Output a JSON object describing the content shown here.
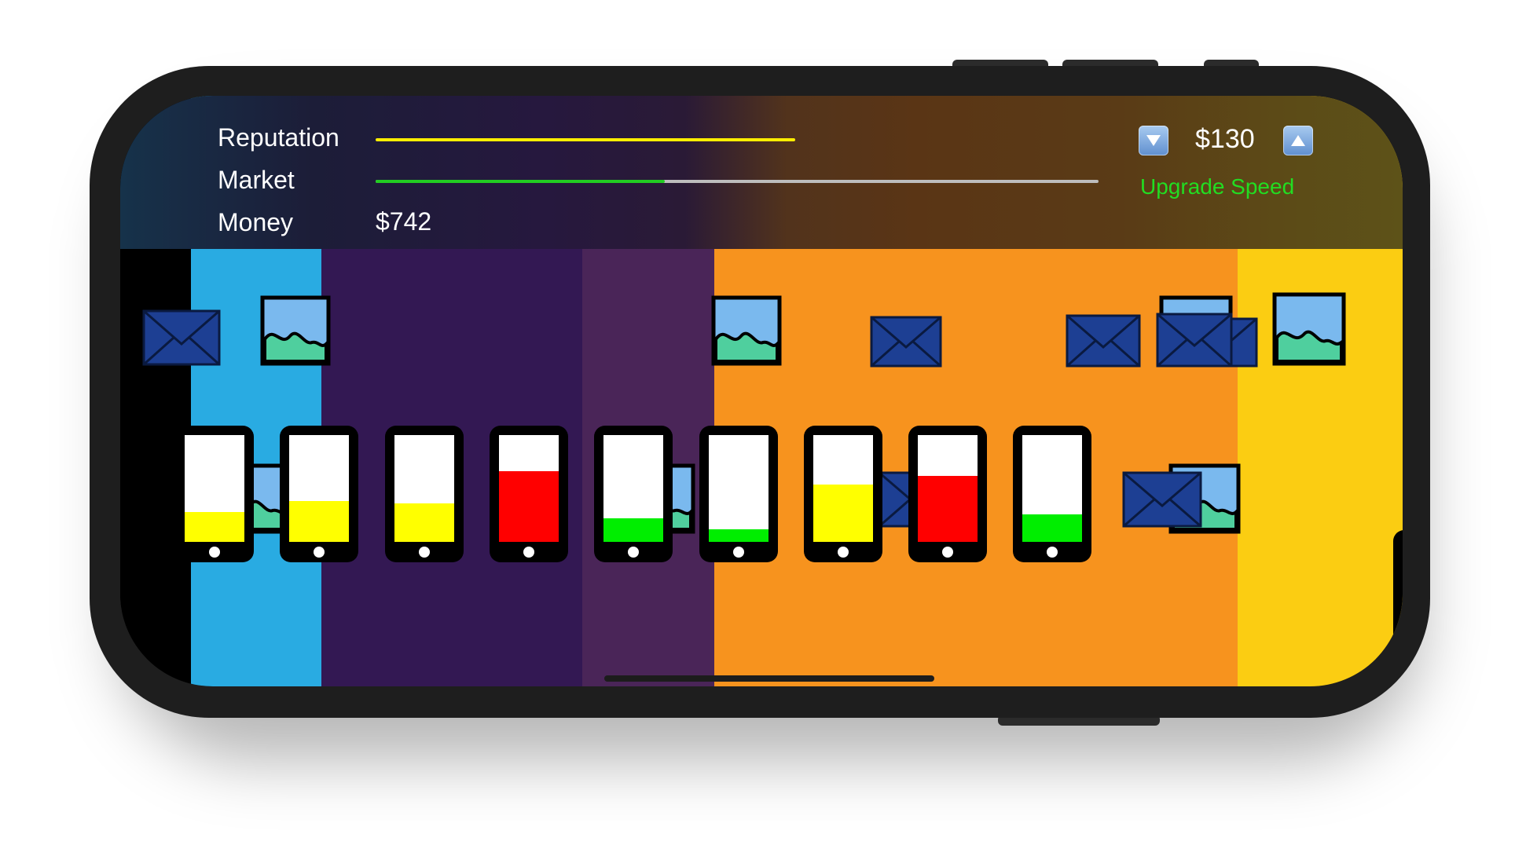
{
  "hud": {
    "reputation_label": "Reputation",
    "market_label": "Market",
    "money_label": "Money",
    "money_value": "$742",
    "reputation_level": 0.58,
    "market_level": 0.4,
    "price": "$130",
    "upgrade_label": "Upgrade Speed",
    "decrease_icon": "triangle-down-icon",
    "increase_icon": "triangle-up-icon"
  },
  "colors": {
    "reputation": "#ffee00",
    "market": "#22cc22",
    "upgrade": "#22dd22",
    "band_black": "#000000",
    "band_blue": "#29abe2",
    "band_purple": "#331853",
    "band_violet": "#4a2558",
    "band_orange": "#f7931e",
    "band_yellow": "#fbcd12",
    "fill_yellow": "#ffff00",
    "fill_red": "#ff0000",
    "fill_green": "#00ee00",
    "envelope": "#1d3f93",
    "image_sky": "#7ab9ee",
    "image_hill": "#4fcf9e"
  },
  "phones": [
    {
      "fill": 0.28,
      "color": "yellow"
    },
    {
      "fill": 0.38,
      "color": "yellow"
    },
    {
      "fill": 0.36,
      "color": "yellow"
    },
    {
      "fill": 0.66,
      "color": "red"
    },
    {
      "fill": 0.22,
      "color": "green"
    },
    {
      "fill": 0.12,
      "color": "green"
    },
    {
      "fill": 0.54,
      "color": "yellow"
    },
    {
      "fill": 0.62,
      "color": "red"
    },
    {
      "fill": 0.26,
      "color": "green"
    }
  ],
  "packet_icons": [
    "envelope-icon",
    "image-icon"
  ]
}
